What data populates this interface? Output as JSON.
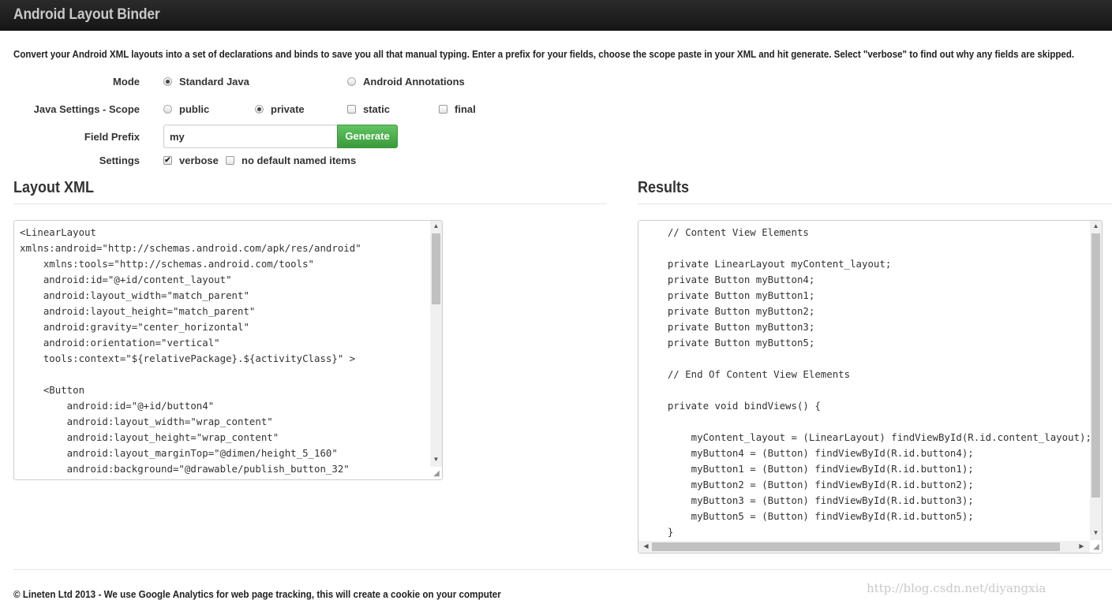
{
  "app": {
    "title": "Android Layout Binder"
  },
  "intro": "Convert your Android XML layouts into a set of declarations and binds to save you all that manual typing. Enter a prefix for your fields, choose the scope paste in your XML and hit generate. Select \"verbose\" to find out why any fields are skipped.",
  "form": {
    "mode": {
      "label": "Mode",
      "options": [
        {
          "label": "Standard Java",
          "selected": true
        },
        {
          "label": "Android Annotations",
          "selected": false
        }
      ]
    },
    "scope": {
      "label": "Java Settings - Scope",
      "options": [
        {
          "label": "public",
          "selected": false
        },
        {
          "label": "private",
          "selected": true
        }
      ],
      "modifiers": [
        {
          "label": "static",
          "checked": false
        },
        {
          "label": "final",
          "checked": false
        }
      ]
    },
    "prefix": {
      "label": "Field Prefix",
      "value": "my"
    },
    "generate_label": "Generate",
    "settings": {
      "label": "Settings",
      "options": [
        {
          "label": "verbose",
          "checked": true
        },
        {
          "label": "no default named items",
          "checked": false
        }
      ]
    }
  },
  "layout_xml": {
    "heading": "Layout XML",
    "text": "<LinearLayout\nxmlns:android=\"http://schemas.android.com/apk/res/android\"\n    xmlns:tools=\"http://schemas.android.com/tools\"\n    android:id=\"@+id/content_layout\"\n    android:layout_width=\"match_parent\"\n    android:layout_height=\"match_parent\"\n    android:gravity=\"center_horizontal\"\n    android:orientation=\"vertical\"\n    tools:context=\"${relativePackage}.${activityClass}\" >\n\n    <Button\n        android:id=\"@+id/button4\"\n        android:layout_width=\"wrap_content\"\n        android:layout_height=\"wrap_content\"\n        android:layout_marginTop=\"@dimen/height_5_160\"\n        android:background=\"@drawable/publish_button_32\""
  },
  "results": {
    "heading": "Results",
    "text": "    // Content View Elements\n\n    private LinearLayout myContent_layout;\n    private Button myButton4;\n    private Button myButton1;\n    private Button myButton2;\n    private Button myButton3;\n    private Button myButton5;\n\n    // End Of Content View Elements\n\n    private void bindViews() {\n\n        myContent_layout = (LinearLayout) findViewById(R.id.content_layout);\n        myButton4 = (Button) findViewById(R.id.button4);\n        myButton1 = (Button) findViewById(R.id.button1);\n        myButton2 = (Button) findViewById(R.id.button2);\n        myButton3 = (Button) findViewById(R.id.button3);\n        myButton5 = (Button) findViewById(R.id.button5);\n    }"
  },
  "footer": "© Lineten Ltd 2013 - We use Google Analytics for web page tracking, this will create a cookie on your computer",
  "watermark": "http://blog.csdn.net/diyangxia"
}
